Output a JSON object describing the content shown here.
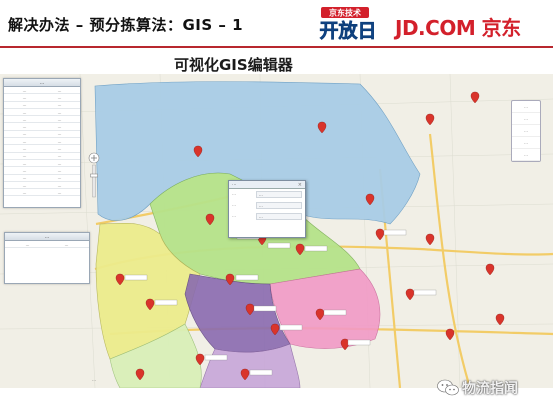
{
  "header": {
    "title": "解决办法 – 预分拣算法：GIS – 1",
    "open_logo_top": "京东技术",
    "open_logo_main": "开放日",
    "jd_logo": "JD.COM 京东"
  },
  "editor": {
    "title": "可视化GIS编辑器"
  },
  "site_list": {
    "header": "…",
    "rows": [
      [
        "…",
        "…"
      ],
      [
        "…",
        "…"
      ],
      [
        "…",
        "…"
      ],
      [
        "…",
        "…"
      ],
      [
        "…",
        "…"
      ],
      [
        "…",
        "…"
      ],
      [
        "…",
        "…"
      ],
      [
        "…",
        "…"
      ],
      [
        "…",
        "…"
      ],
      [
        "…",
        "…"
      ],
      [
        "…",
        "…"
      ],
      [
        "…",
        "…"
      ],
      [
        "…",
        "…"
      ],
      [
        "…",
        "…"
      ],
      [
        "…",
        "…"
      ]
    ]
  },
  "zone_list": {
    "header": "…",
    "rows": [
      [
        "…",
        "…"
      ]
    ]
  },
  "toolbar": {
    "items": [
      "…",
      "…",
      "…",
      "…",
      "…"
    ]
  },
  "info_popup": {
    "title": "…",
    "close": "×",
    "rows": [
      {
        "key": "…",
        "value": "…"
      },
      {
        "key": "…",
        "value": "…"
      },
      {
        "key": "…",
        "value": "…"
      }
    ]
  },
  "map_footer": "…",
  "watermark": "物流指闻",
  "colors": {
    "brand_red": "#d3202b",
    "zone_blue": "#a9cde6",
    "zone_green": "#b6e38a",
    "zone_yellow": "#ecec8c",
    "zone_purple": "#8a6bb0",
    "zone_pink": "#f29ac6",
    "marker_red": "#d9342b"
  }
}
